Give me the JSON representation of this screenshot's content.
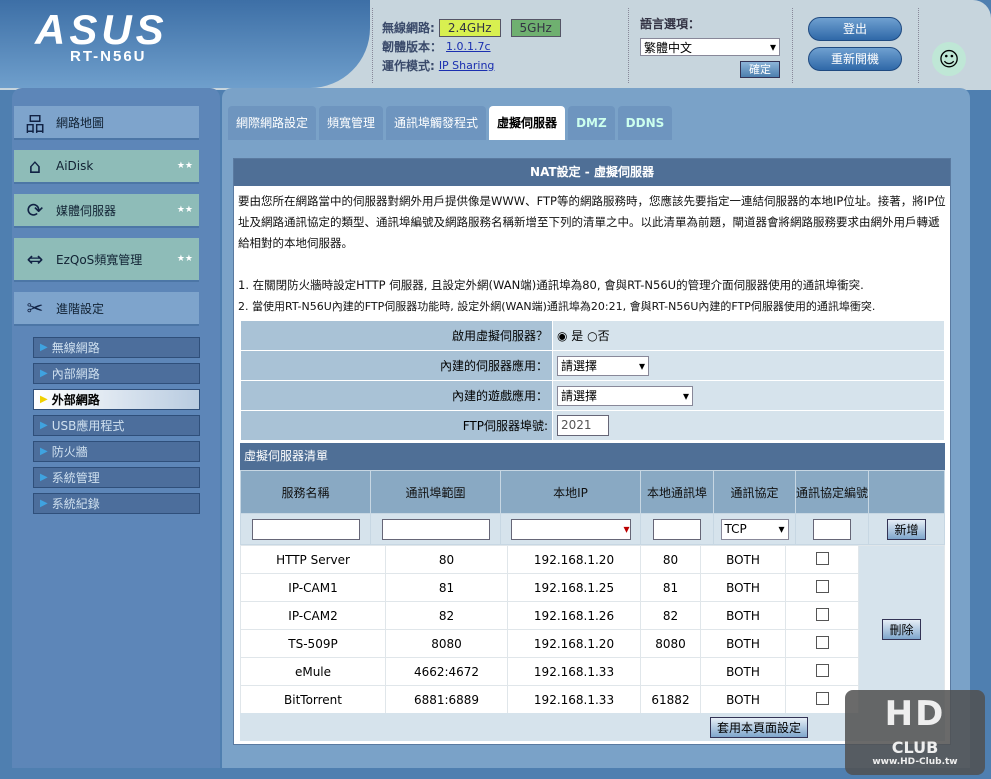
{
  "header": {
    "brand": "ASUS",
    "model": "RT-N56U",
    "wireless_label": "無線網路:",
    "band_24": "2.4GHz",
    "band_5": "5GHz",
    "firmware_label": "韌體版本：",
    "firmware": "1.0.1.7c",
    "mode_label": "運作模式:",
    "mode": "IP Sharing",
    "lang_label": "語言選項：",
    "lang_value": "繁體中文",
    "lang_apply": "確定",
    "logout": "登出",
    "reboot": "重新開機"
  },
  "sidebar": {
    "items": [
      {
        "label": "網路地圖"
      },
      {
        "label": "AiDisk"
      },
      {
        "label": "媒體伺服器"
      },
      {
        "label": "EzQoS頻寬管理"
      },
      {
        "label": "進階設定"
      }
    ],
    "sub": [
      {
        "label": "無線網路"
      },
      {
        "label": "內部網路"
      },
      {
        "label": "外部網路"
      },
      {
        "label": "USB應用程式"
      },
      {
        "label": "防火牆"
      },
      {
        "label": "系統管理"
      },
      {
        "label": "系統紀錄"
      }
    ]
  },
  "tabs": [
    {
      "label": "網際網路設定"
    },
    {
      "label": "頻寬管理"
    },
    {
      "label": "通訊埠觸發程式"
    },
    {
      "label": "虛擬伺服器"
    },
    {
      "label": "DMZ"
    },
    {
      "label": "DDNS"
    }
  ],
  "panel": {
    "title": "NAT設定 - 虛擬伺服器",
    "desc": "要由您所在網路當中的伺服器對網外用戶提供像是WWW、FTP等的網路服務時，您應該先要指定一連結伺服器的本地IP位址。接著，將IP位址及網路通訊協定的類型、通訊埠編號及網路服務名稱新增至下列的清單之中。以此清單為前題，閘道器會將網路服務要求由網外用戶轉遞給相對的本地伺服器。",
    "note1": "1. 在關閉防火牆時設定HTTP 伺服器, 且設定外網(WAN端)通訊埠為80, 會與RT-N56U的管理介面伺服器使用的通訊埠衝突.",
    "note2": "2. 當使用RT-N56U內建的FTP伺服器功能時, 設定外網(WAN端)通訊埠為20:21, 會與RT-N56U內建的FTP伺服器使用的通訊埠衝突.",
    "enable_label": "啟用虛擬伺服器？",
    "yes": "是",
    "no": "否",
    "builtin_app_label": "內建的伺服器應用：",
    "builtin_app_value": "請選擇",
    "game_label": "內建的遊戲應用：",
    "game_value": "請選擇",
    "ftp_label": "FTP伺服器埠號:",
    "ftp_value": "2021",
    "list_title": "虛擬伺服器清單",
    "columns": [
      "服務名稱",
      "通訊埠範圍",
      "本地IP",
      "本地通訊埠",
      "通訊協定",
      "通訊協定編號"
    ],
    "protocol_default": "TCP",
    "add": "新增",
    "delete": "刪除",
    "apply": "套用本頁面設定",
    "rows": [
      {
        "name": "HTTP Server",
        "range": "80",
        "ip": "192.168.1.20",
        "port": "80",
        "proto": "BOTH"
      },
      {
        "name": "IP-CAM1",
        "range": "81",
        "ip": "192.168.1.25",
        "port": "81",
        "proto": "BOTH"
      },
      {
        "name": "IP-CAM2",
        "range": "82",
        "ip": "192.168.1.26",
        "port": "82",
        "proto": "BOTH"
      },
      {
        "name": "TS-509P",
        "range": "8080",
        "ip": "192.168.1.20",
        "port": "8080",
        "proto": "BOTH"
      },
      {
        "name": "eMule",
        "range": "4662:4672",
        "ip": "192.168.1.33",
        "port": "",
        "proto": "BOTH"
      },
      {
        "name": "BitTorrent",
        "range": "6881:6889",
        "ip": "192.168.1.33",
        "port": "61882",
        "proto": "BOTH"
      }
    ]
  },
  "watermark": {
    "logo": "HD CLUB",
    "url": "www.HD-Club.tw"
  }
}
